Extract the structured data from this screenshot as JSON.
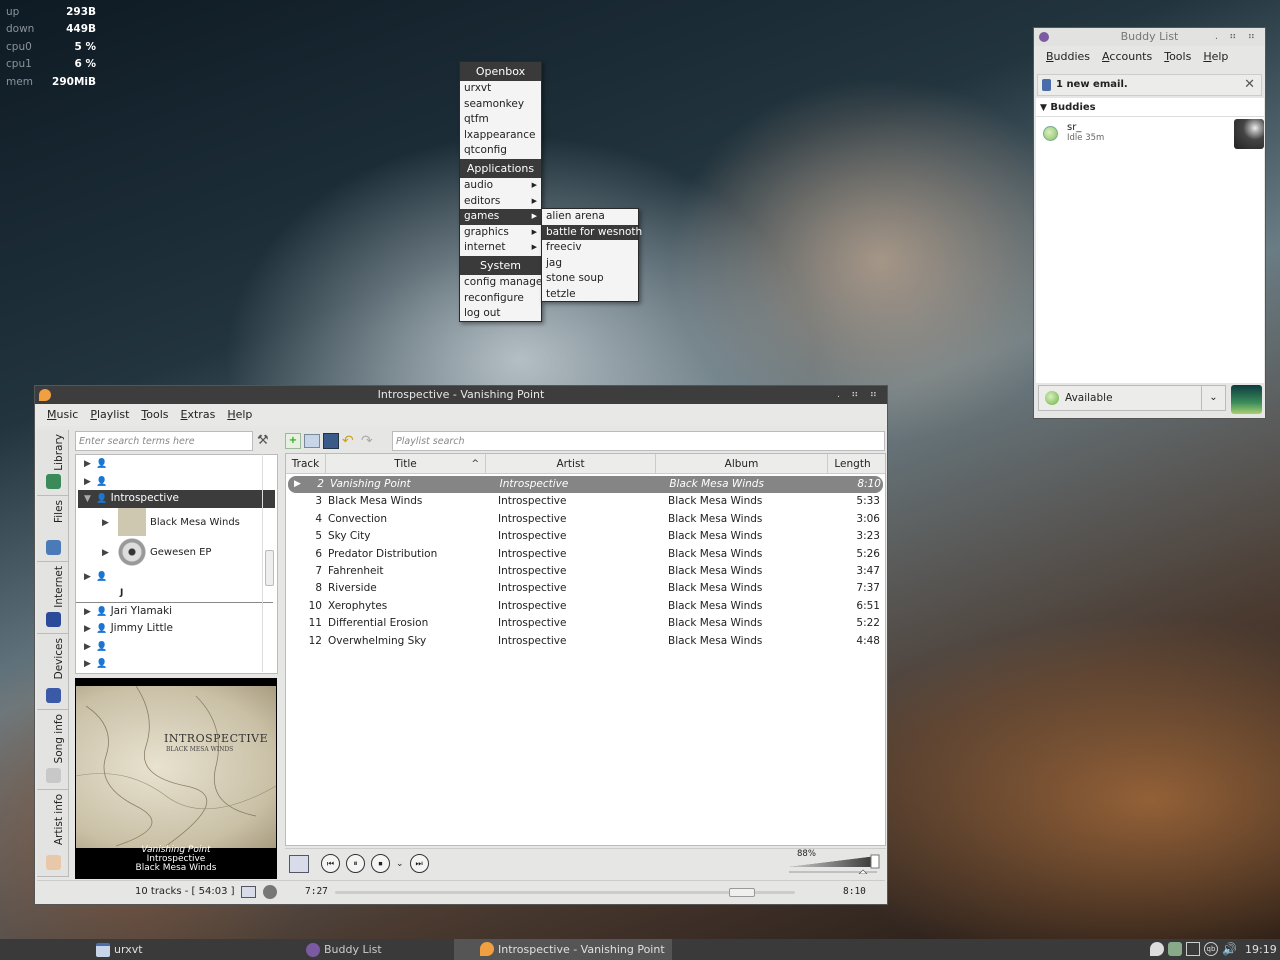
{
  "conky": [
    {
      "k": "up",
      "v": "293B"
    },
    {
      "k": "down",
      "v": "449B"
    },
    {
      "k": "cpu0",
      "v": "5 %"
    },
    {
      "k": "cpu1",
      "v": "6 %"
    },
    {
      "k": "mem",
      "v": "290MiB"
    }
  ],
  "openbox_menu": {
    "header": "Openbox",
    "items": [
      "urxvt",
      "seamonkey",
      "qtfm",
      "lxappearance",
      "qtconfig"
    ],
    "apps_header": "Applications",
    "apps": [
      "audio",
      "editors",
      "games",
      "graphics",
      "internet"
    ],
    "system_header": "System",
    "system": [
      "config manager",
      "reconfigure",
      "log out"
    ]
  },
  "games_menu": [
    "alien arena",
    "battle for wesnoth",
    "freeciv",
    "jag",
    "stone soup",
    "tetzle"
  ],
  "buddy_list": {
    "title": "Buddy List",
    "menu": [
      "Buddies",
      "Accounts",
      "Tools",
      "Help"
    ],
    "notice": "1 new email.",
    "group": "Buddies",
    "buddy_name": "sr_",
    "buddy_status": "Idle 35m",
    "status": "Available"
  },
  "amarok": {
    "title": "Introspective - Vanishing Point",
    "menu": [
      "Music",
      "Playlist",
      "Tools",
      "Extras",
      "Help"
    ],
    "tabs": [
      "Library",
      "Files",
      "Internet",
      "Devices",
      "Song info",
      "Artist info"
    ],
    "search_placeholder": "Enter search terms here",
    "playlist_placeholder": "Playlist search",
    "tree": {
      "artist": "Introspective",
      "albums": [
        "Black Mesa Winds",
        "Gewesen EP"
      ],
      "other_label": "J",
      "artists": [
        "Jari Ylamaki",
        "Jimmy Little"
      ]
    },
    "cover": {
      "title": "INTROSPECTIVE",
      "subtitle": "BLACK MESA WINDS",
      "np_track": "Vanishing Point",
      "np_artist": "Introspective",
      "np_album": "Black Mesa Winds"
    },
    "columns": [
      "Track",
      "Title",
      "Artist",
      "Album",
      "Length"
    ],
    "rows": [
      {
        "t": "2",
        "title": "Vanishing Point",
        "artist": "Introspective",
        "album": "Black Mesa Winds",
        "len": "8:10"
      },
      {
        "t": "3",
        "title": "Black Mesa Winds",
        "artist": "Introspective",
        "album": "Black Mesa Winds",
        "len": "5:33"
      },
      {
        "t": "4",
        "title": "Convection",
        "artist": "Introspective",
        "album": "Black Mesa Winds",
        "len": "3:06"
      },
      {
        "t": "5",
        "title": "Sky City",
        "artist": "Introspective",
        "album": "Black Mesa Winds",
        "len": "3:23"
      },
      {
        "t": "6",
        "title": "Predator Distribution",
        "artist": "Introspective",
        "album": "Black Mesa Winds",
        "len": "5:26"
      },
      {
        "t": "7",
        "title": "Fahrenheit",
        "artist": "Introspective",
        "album": "Black Mesa Winds",
        "len": "3:47"
      },
      {
        "t": "8",
        "title": "Riverside",
        "artist": "Introspective",
        "album": "Black Mesa Winds",
        "len": "7:37"
      },
      {
        "t": "10",
        "title": "Xerophytes",
        "artist": "Introspective",
        "album": "Black Mesa Winds",
        "len": "6:51"
      },
      {
        "t": "11",
        "title": "Differential Erosion",
        "artist": "Introspective",
        "album": "Black Mesa Winds",
        "len": "5:22"
      },
      {
        "t": "12",
        "title": "Overwhelming Sky",
        "artist": "Introspective",
        "album": "Black Mesa Winds",
        "len": "4:48"
      }
    ],
    "volume": "88%",
    "track_count": "10 tracks - [ 54:03 ]",
    "elapsed": "7:27",
    "total": "8:10",
    "progress": 0.913
  },
  "taskbar": {
    "tasks": [
      "urxvt",
      "Buddy List",
      "Introspective - Vanishing Point"
    ],
    "clock": "19:19"
  }
}
